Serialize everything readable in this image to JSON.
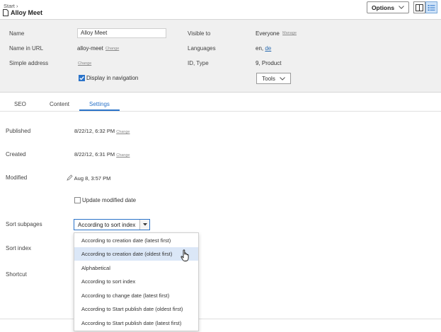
{
  "header": {
    "breadcrumb": "Start",
    "page_title": "Alloy Meet",
    "options_label": "Options"
  },
  "properties": {
    "name_label": "Name",
    "name_value": "Alloy Meet",
    "url_label": "Name in URL",
    "url_value": "alloy-meet",
    "url_change": "Change",
    "simple_address_label": "Simple address",
    "simple_address_change": "Change",
    "display_in_nav_label": "Display in navigation",
    "display_in_nav_checked": true,
    "visible_to_label": "Visible to",
    "visible_to_value": "Everyone",
    "visible_to_manage": "Manage",
    "languages_label": "Languages",
    "languages_value_prefix": "en,",
    "languages_link": "de",
    "id_type_label": "ID, Type",
    "id_type_value": "9, Product",
    "tools_label": "Tools"
  },
  "tabs": [
    {
      "label": "SEO"
    },
    {
      "label": "Content"
    },
    {
      "label": "Settings",
      "active": true
    }
  ],
  "settings": {
    "published_label": "Published",
    "published_value": "8/22/12, 6:32 PM",
    "published_change": "Change",
    "created_label": "Created",
    "created_value": "8/22/12, 6:31 PM",
    "created_change": "Change",
    "modified_label": "Modified",
    "modified_value": "Aug 8, 3:57 PM",
    "update_modified_label": "Update modified date",
    "sort_subpages_label": "Sort subpages",
    "sort_subpages_value": "According to sort index",
    "sort_index_label": "Sort index",
    "shortcut_label": "Shortcut"
  },
  "dropdown": {
    "options": [
      "According to creation date (latest first)",
      "According to creation date (oldest first)",
      "Alphabetical",
      "According to sort index",
      "According to change date (latest first)",
      "According to Start publish date (oldest first)",
      "According to Start publish date (latest first)"
    ],
    "hovered_index": 1
  },
  "colors": {
    "accent": "#2a73c9",
    "panel_bg": "#f0f0f0",
    "hover_bg": "#dbe7f7"
  }
}
